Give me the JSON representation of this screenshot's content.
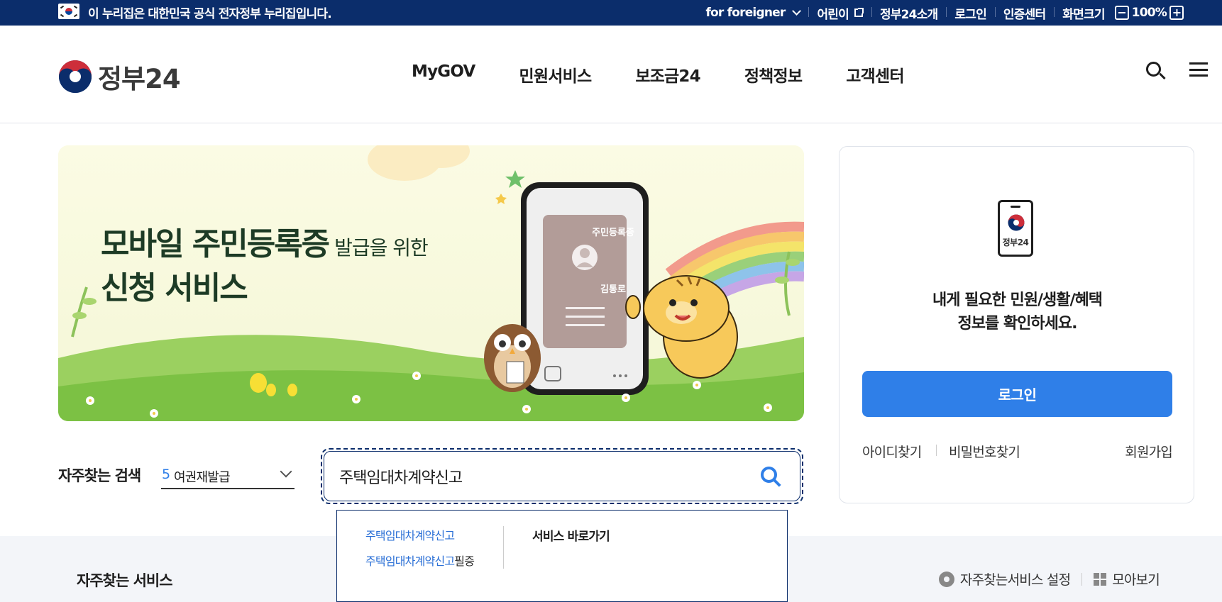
{
  "topbar": {
    "notice": "이 누리집은 대한민국 공식 전자정부 누리집입니다.",
    "foreigner": "for foreigner",
    "kids": "어린이",
    "about": "정부24소개",
    "login": "로그인",
    "cert": "인증센터",
    "zoom_label": "화면크기",
    "zoom_minus": "−",
    "zoom_value": "100%",
    "zoom_plus": "+"
  },
  "header": {
    "logo_text": "정부24",
    "nav": [
      "MyGOV",
      "민원서비스",
      "보조금24",
      "정책정보",
      "고객센터"
    ]
  },
  "banner": {
    "headline_main": "모바일 주민등록증",
    "headline_small": " 발급을 위한",
    "headline_line2": "신청 서비스",
    "card_title": "주민등록증",
    "card_name": "김통로"
  },
  "login_box": {
    "phone_label": "정부24",
    "message_line1": "내게 필요한 민원/생활/혜택",
    "message_line2": "정보를 확인하세요.",
    "login_button": "로그인",
    "find_id": "아이디찾기",
    "find_pw": "비밀번호찾기",
    "join": "회원가입"
  },
  "search": {
    "freq_label": "자주찾는 검색",
    "freq_rank": "5",
    "freq_value": "여권재발급",
    "query": "주택임대차계약신고",
    "suggestions": [
      {
        "match": "주택임대차계약신고",
        "rest": ""
      },
      {
        "match": "주택임대차계약신고",
        "rest": "필증"
      }
    ],
    "shortcut_title": "서비스 바로가기"
  },
  "frequent_services": {
    "title": "자주찾는 서비스",
    "settings": "자주찾는서비스 설정",
    "view_all": "모아보기"
  },
  "colors": {
    "topbar_bg": "#0b2d6b",
    "accent_blue": "#2f7fe8",
    "bottom_bg": "#f3f5f9"
  },
  "icons": [
    "korea-flag-icon",
    "chevron-down-icon",
    "external-link-icon",
    "search-icon",
    "menu-icon",
    "mobile-id-icon",
    "gear-icon",
    "grid-icon"
  ]
}
